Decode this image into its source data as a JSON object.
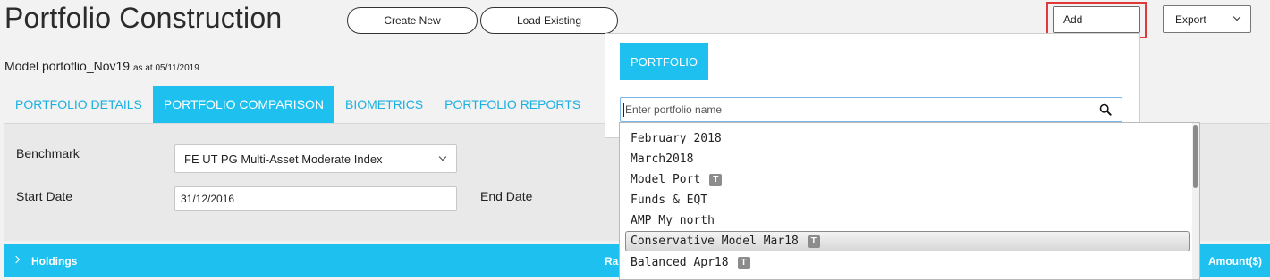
{
  "header": {
    "title": "Portfolio Construction",
    "create_new_label": "Create New",
    "load_existing_label": "Load Existing",
    "add_label": "Add",
    "export_label": "Export"
  },
  "model": {
    "name": "Model portoflio_Nov19",
    "as_at": "as at 05/11/2019"
  },
  "tabs": [
    {
      "label": "PORTFOLIO DETAILS",
      "active": false
    },
    {
      "label": "PORTFOLIO COMPARISON",
      "active": true
    },
    {
      "label": "BIOMETRICS",
      "active": false
    },
    {
      "label": "PORTFOLIO REPORTS",
      "active": false
    }
  ],
  "filters": {
    "benchmark_label": "Benchmark",
    "benchmark_value": "FE UT PG Multi-Asset Moderate Index",
    "start_date_label": "Start Date",
    "start_date_value": "31/12/2016",
    "end_date_label": "End Date"
  },
  "holdings": {
    "label": "Holdings",
    "ra_label": "Ra",
    "amount_label": "Amount($)"
  },
  "add_dropdown": {
    "portfolio_label": "PORTFOLIO",
    "search_placeholder": "Enter portfolio name",
    "items": [
      {
        "label": "February 2018",
        "tag": ""
      },
      {
        "label": "March2018",
        "tag": ""
      },
      {
        "label": "Model Port",
        "tag": "T"
      },
      {
        "label": "Funds & EQT",
        "tag": ""
      },
      {
        "label": "AMP My north",
        "tag": ""
      },
      {
        "label": "Conservative Model Mar18",
        "tag": "T",
        "highlighted": true
      },
      {
        "label": "Balanced Apr18",
        "tag": "T"
      }
    ]
  },
  "colors": {
    "accent": "#1ec0ef",
    "tab_text": "#1ab0e0",
    "highlight_border": "#e0393a",
    "panel_bg": "#e9e9e9"
  }
}
